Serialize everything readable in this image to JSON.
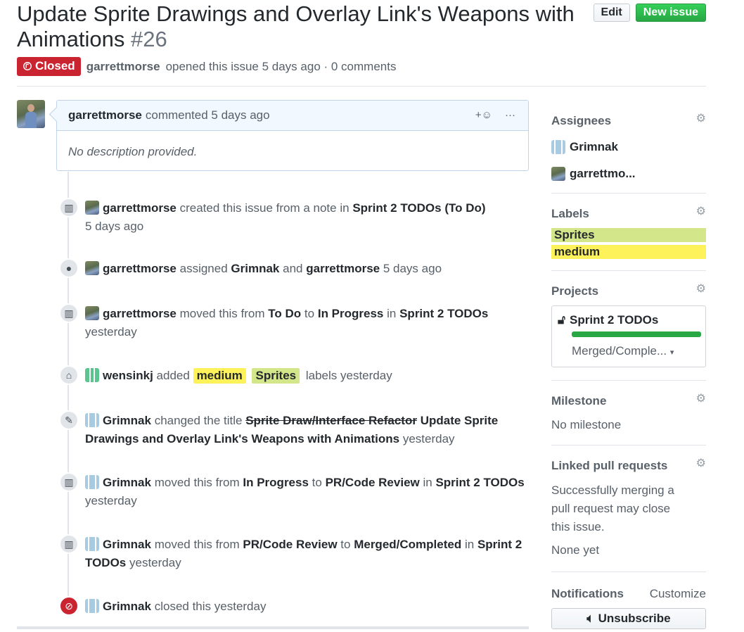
{
  "issue": {
    "title": "Update Sprite Drawings and Overlay Link's Weapons with Animations",
    "number": "#26",
    "state": "Closed",
    "author": "garrettmorse",
    "opened_text": "opened this issue 5 days ago · 0 comments"
  },
  "header_buttons": {
    "edit": "Edit",
    "new_issue": "New issue"
  },
  "comment": {
    "author": "garrettmorse",
    "meta": "commented 5 days ago",
    "reaction": "+☺",
    "more": "···",
    "body": "No description provided."
  },
  "timeline": {
    "e1": {
      "user": "garrettmorse",
      "t1": "created this issue from a note in",
      "project": "Sprint 2 TODOs",
      "col": "(To Do)",
      "time": "5 days ago"
    },
    "e2": {
      "user": "garrettmorse",
      "t1": "assigned",
      "a1": "Grimnak",
      "t2": "and",
      "a2": "garrettmorse",
      "time": "5 days ago"
    },
    "e3": {
      "user": "garrettmorse",
      "t1": "moved this from",
      "from": "To Do",
      "t2": "to",
      "to": "In Progress",
      "t3": "in",
      "project": "Sprint 2 TODOs",
      "time": "yesterday"
    },
    "e4": {
      "user": "wensinkj",
      "t1": "added",
      "l1": "medium",
      "l2": "Sprites",
      "t2": "labels yesterday"
    },
    "e5": {
      "user": "Grimnak",
      "t1": "changed the title",
      "old": "Sprite Draw/Interface Refactor",
      "new": "Update Sprite Drawings and Overlay Link's Weapons with Animations",
      "time": "yesterday"
    },
    "e6": {
      "user": "Grimnak",
      "t1": "moved this from",
      "from": "In Progress",
      "t2": "to",
      "to": "PR/Code Review",
      "t3": "in",
      "project": "Sprint 2 TODOs",
      "time": "yesterday"
    },
    "e7": {
      "user": "Grimnak",
      "t1": "moved this from",
      "from": "PR/Code Review",
      "t2": "to",
      "to": "Merged/Completed",
      "t3": "in",
      "project": "Sprint 2 TODOs",
      "time": "yesterday"
    },
    "e8": {
      "user": "Grimnak",
      "t1": "closed this yesterday"
    }
  },
  "sidebar": {
    "assignees": {
      "heading": "Assignees",
      "items": [
        "Grimnak",
        "garrettmo..."
      ]
    },
    "labels": {
      "heading": "Labels",
      "items": [
        "Sprites",
        "medium"
      ]
    },
    "projects": {
      "heading": "Projects",
      "name": "Sprint 2 TODOs",
      "column": "Merged/Comple...",
      "progress": 1.0
    },
    "milestone": {
      "heading": "Milestone",
      "value": "No milestone"
    },
    "linked": {
      "heading": "Linked pull requests",
      "text": "Successfully merging a pull request may close this issue.",
      "value": "None yet"
    },
    "notifications": {
      "heading": "Notifications",
      "customize": "Customize",
      "unsubscribe": "Unsubscribe"
    }
  },
  "colors": {
    "closed": "#cb2431",
    "green": "#28a745",
    "medium": "#fef25a",
    "sprites": "#d4e68a"
  }
}
